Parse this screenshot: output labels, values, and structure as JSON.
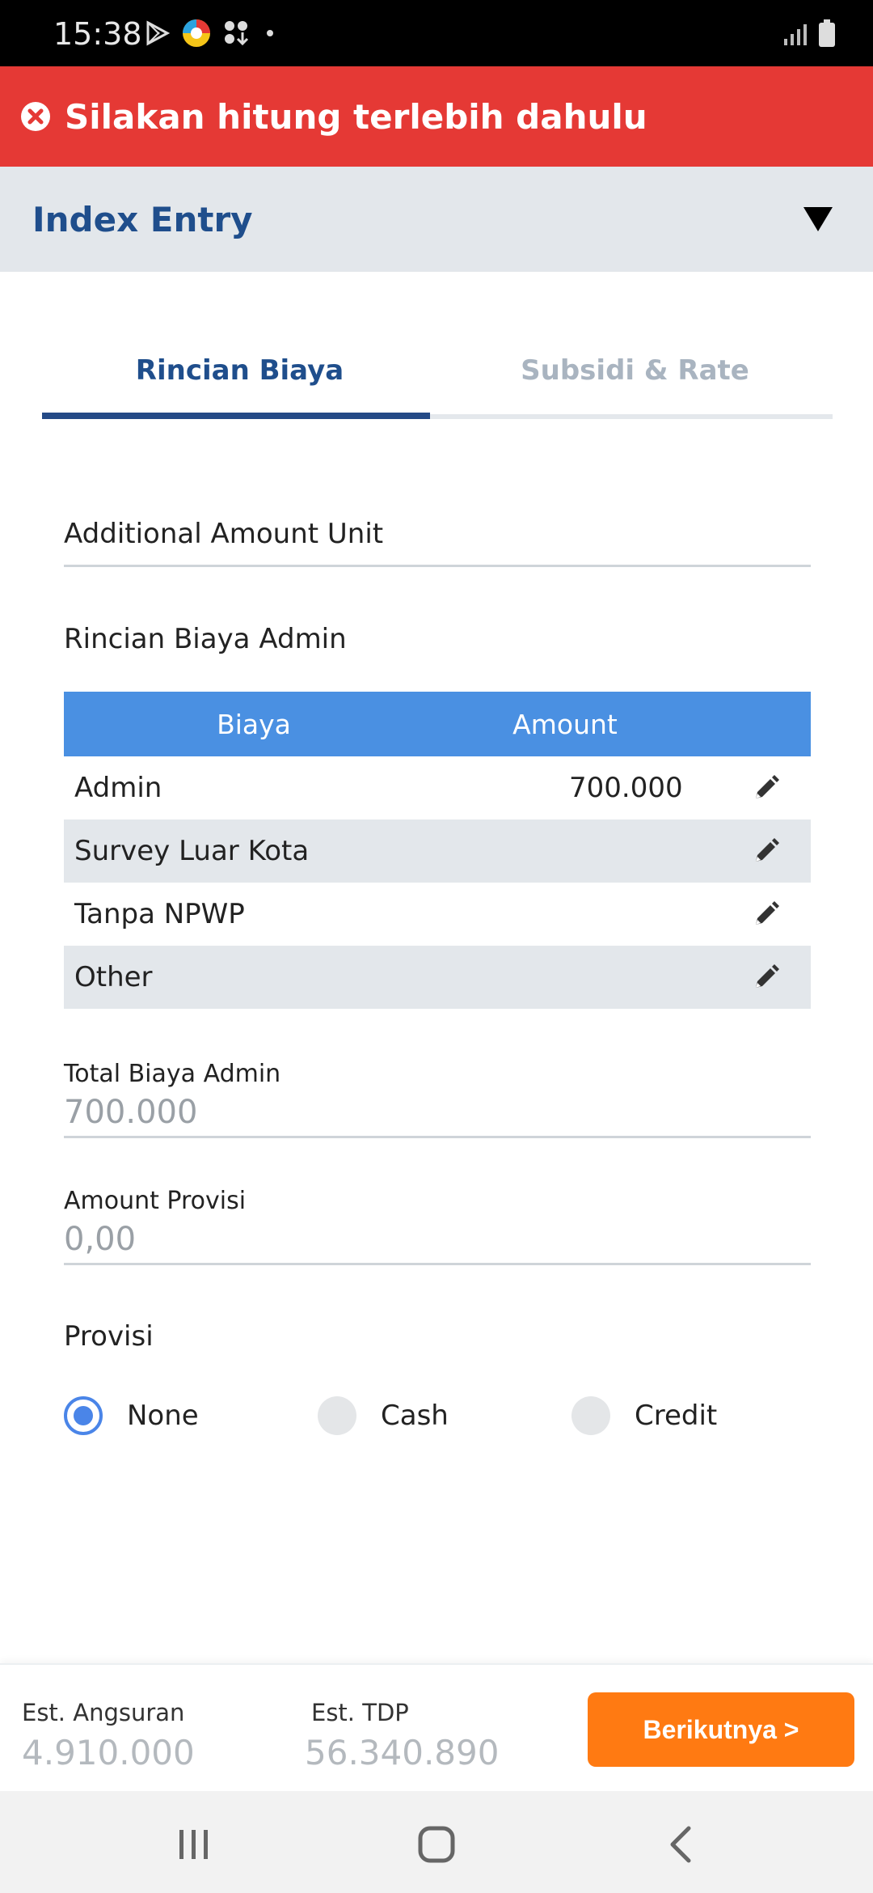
{
  "status_bar": {
    "time": "15:38",
    "left_icons": [
      "play-store-icon",
      "app-icon",
      "download-icon",
      "dot-icon"
    ],
    "right_icons": [
      "signal-icon",
      "battery-icon"
    ]
  },
  "error_banner": {
    "icon": "close-circle-icon",
    "message": "Silakan hitung terlebih dahulu",
    "color": "#e53935"
  },
  "header": {
    "title": "Index Entry",
    "toggle_icon": "triangle-down-icon"
  },
  "tabs": [
    {
      "label": "Rincian Biaya",
      "active": true
    },
    {
      "label": "Subsidi & Rate",
      "active": false
    }
  ],
  "form": {
    "additional_amount_unit": {
      "label": "Additional Amount Unit"
    },
    "rincian_biaya_admin": {
      "label": "Rincian Biaya Admin",
      "columns": [
        "Biaya",
        "Amount"
      ],
      "rows": [
        {
          "name": "Admin",
          "amount": "700.000"
        },
        {
          "name": "Survey Luar Kota",
          "amount": ""
        },
        {
          "name": "Tanpa NPWP",
          "amount": ""
        },
        {
          "name": "Other",
          "amount": ""
        }
      ]
    },
    "total_biaya_admin": {
      "label": "Total Biaya Admin",
      "value": "700.000"
    },
    "amount_provisi": {
      "label": "Amount Provisi",
      "value": "0,00"
    },
    "provisi": {
      "label": "Provisi",
      "options": [
        "None",
        "Cash",
        "Credit"
      ],
      "selected": "None"
    }
  },
  "footer": {
    "est_angsuran": {
      "label": "Est. Angsuran",
      "value": "4.910.000"
    },
    "est_tdp": {
      "label": "Est. TDP",
      "value": "56.340.890"
    },
    "next_button": "Berikutnya >",
    "accent": "#ff7a12"
  },
  "nav": [
    "recents-icon",
    "home-icon",
    "back-icon"
  ]
}
